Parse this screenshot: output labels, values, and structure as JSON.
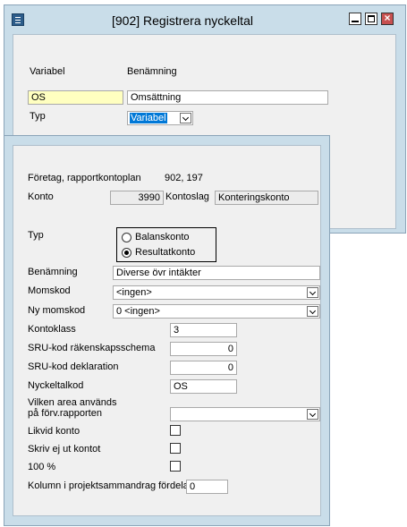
{
  "back_window": {
    "title": "[902]  Registrera nyckeltal",
    "variabel_label": "Variabel",
    "benamning_label": "Benämning",
    "variabel_value": "OS",
    "benamning_value": "Omsättning",
    "typ_label": "Typ",
    "typ_value": "Variabel"
  },
  "front_window": {
    "company_label": "Företag, rapportkontoplan",
    "company_value": "902, 197",
    "konto_label": "Konto",
    "konto_value": "3990",
    "kontoslag_label": "Kontoslag",
    "kontoslag_value": "Konteringskonto",
    "typ_label": "Typ",
    "radio_balans": "Balanskonto",
    "radio_resultat": "Resultatkonto",
    "benamning_label": "Benämning",
    "benamning_value": "Diverse övr intäkter",
    "momskod_label": "Momskod",
    "momskod_value": "<ingen>",
    "ny_momskod_label": "Ny momskod",
    "ny_momskod_value": "0 <ingen>",
    "kontoklass_label": "Kontoklass",
    "kontoklass_value": "3",
    "sru_rakenskap_label": "SRU-kod räkenskapsschema",
    "sru_rakenskap_value": "0",
    "sru_deklaration_label": "SRU-kod deklaration",
    "sru_deklaration_value": "0",
    "nyckeltal_label": "Nyckeltalkod",
    "nyckeltal_value": "OS",
    "area_label_1": "Vilken area används",
    "area_label_2": "på förv.rapporten",
    "area_value": "",
    "likvid_label": "Likvid konto",
    "skriv_label": "Skriv ej ut kontot",
    "procent_label": "100 %",
    "kolumn_label": "Kolumn i projektsammandrag fördelat",
    "kolumn_value": "0"
  }
}
